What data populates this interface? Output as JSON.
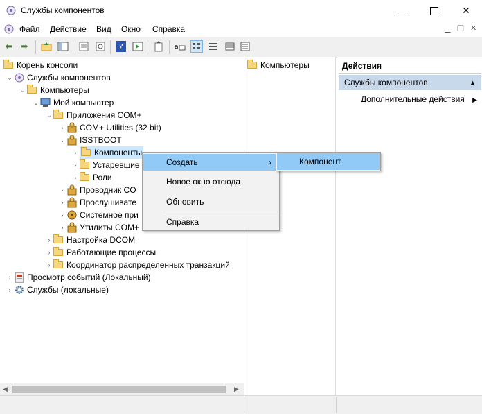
{
  "window": {
    "title": "Службы компонентов"
  },
  "menubar": {
    "items": [
      "Файл",
      "Действие",
      "Вид",
      "Окно",
      "Справка"
    ]
  },
  "tree": {
    "nodes": [
      {
        "label": "Корень консоли"
      },
      {
        "label": "Службы компонентов"
      },
      {
        "label": "Компьютеры"
      },
      {
        "label": "Мой компьютер"
      },
      {
        "label": "Приложения COM+"
      },
      {
        "label": "COM+ Utilities (32 bit)"
      },
      {
        "label": "ISSTBOOT"
      },
      {
        "label": "Компоненты"
      },
      {
        "label": "Устаревшие"
      },
      {
        "label": "Роли"
      },
      {
        "label": "Проводник CO"
      },
      {
        "label": "Прослушивате"
      },
      {
        "label": "Системное при"
      },
      {
        "label": "Утилиты COM+"
      },
      {
        "label": "Настройка DCOM"
      },
      {
        "label": "Работающие процессы"
      },
      {
        "label": "Координатор распределенных транзакций"
      },
      {
        "label": "Просмотр событий (Локальный)"
      },
      {
        "label": "Службы (локальные)"
      }
    ]
  },
  "list": {
    "items": [
      "Компьютеры"
    ]
  },
  "actions": {
    "header": "Действия",
    "section": "Службы компонентов",
    "items": [
      "Дополнительные действия"
    ]
  },
  "context_menu": {
    "items": [
      "Создать",
      "Новое окно отсюда",
      "Обновить",
      "Справка"
    ],
    "submenu": [
      "Компонент"
    ]
  },
  "colors": {
    "selection": "#cce8ff",
    "menu_highlight": "#91c9f7",
    "actions_section": "#c9d9ec"
  }
}
